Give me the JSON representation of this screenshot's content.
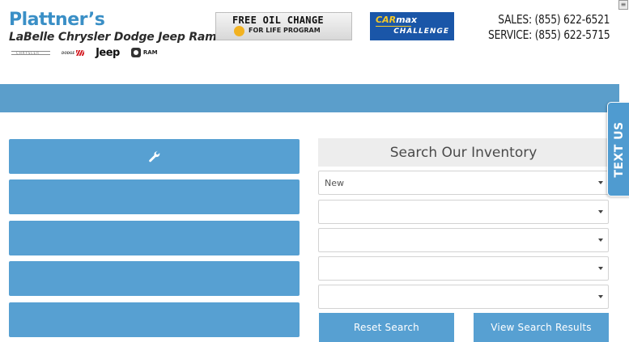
{
  "header": {
    "logo_title": "Plattner’s",
    "logo_subtitle": "LaBelle Chrysler Dodge Jeep Ram",
    "brands": {
      "chrysler": "CHRYSLER",
      "dodge": "DODGE",
      "jeep": "Jeep",
      "ram": "RAM"
    },
    "oil_banner": {
      "line1": "FREE OIL CHANGE",
      "line2": "FOR LIFE PROGRAM"
    },
    "carmax_banner": {
      "car": "CAR",
      "max": "max",
      "challenge": "CHALLENGE"
    },
    "sales_phone": "SALES: (855) 622-6521",
    "service_phone": "SERVICE: (855) 622-5715",
    "corner_box": "≡"
  },
  "tiles": [
    {
      "icon": "wrench-icon",
      "label": ""
    },
    {
      "label": ""
    },
    {
      "label": ""
    },
    {
      "label": ""
    },
    {
      "label": ""
    }
  ],
  "search": {
    "title": "Search Our Inventory",
    "selects": [
      {
        "value": "New"
      },
      {
        "value": ""
      },
      {
        "value": ""
      },
      {
        "value": ""
      },
      {
        "value": ""
      }
    ],
    "reset_label": "Reset Search",
    "view_label": "View Search Results"
  },
  "text_us": {
    "label": "TEXT US"
  },
  "colors": {
    "accent_blue": "#57a0d2",
    "nav_blue": "#5b9ecb",
    "logo_blue": "#3a8fc6",
    "carmax_blue": "#1a56a8",
    "carmax_yellow": "#f6c928"
  }
}
